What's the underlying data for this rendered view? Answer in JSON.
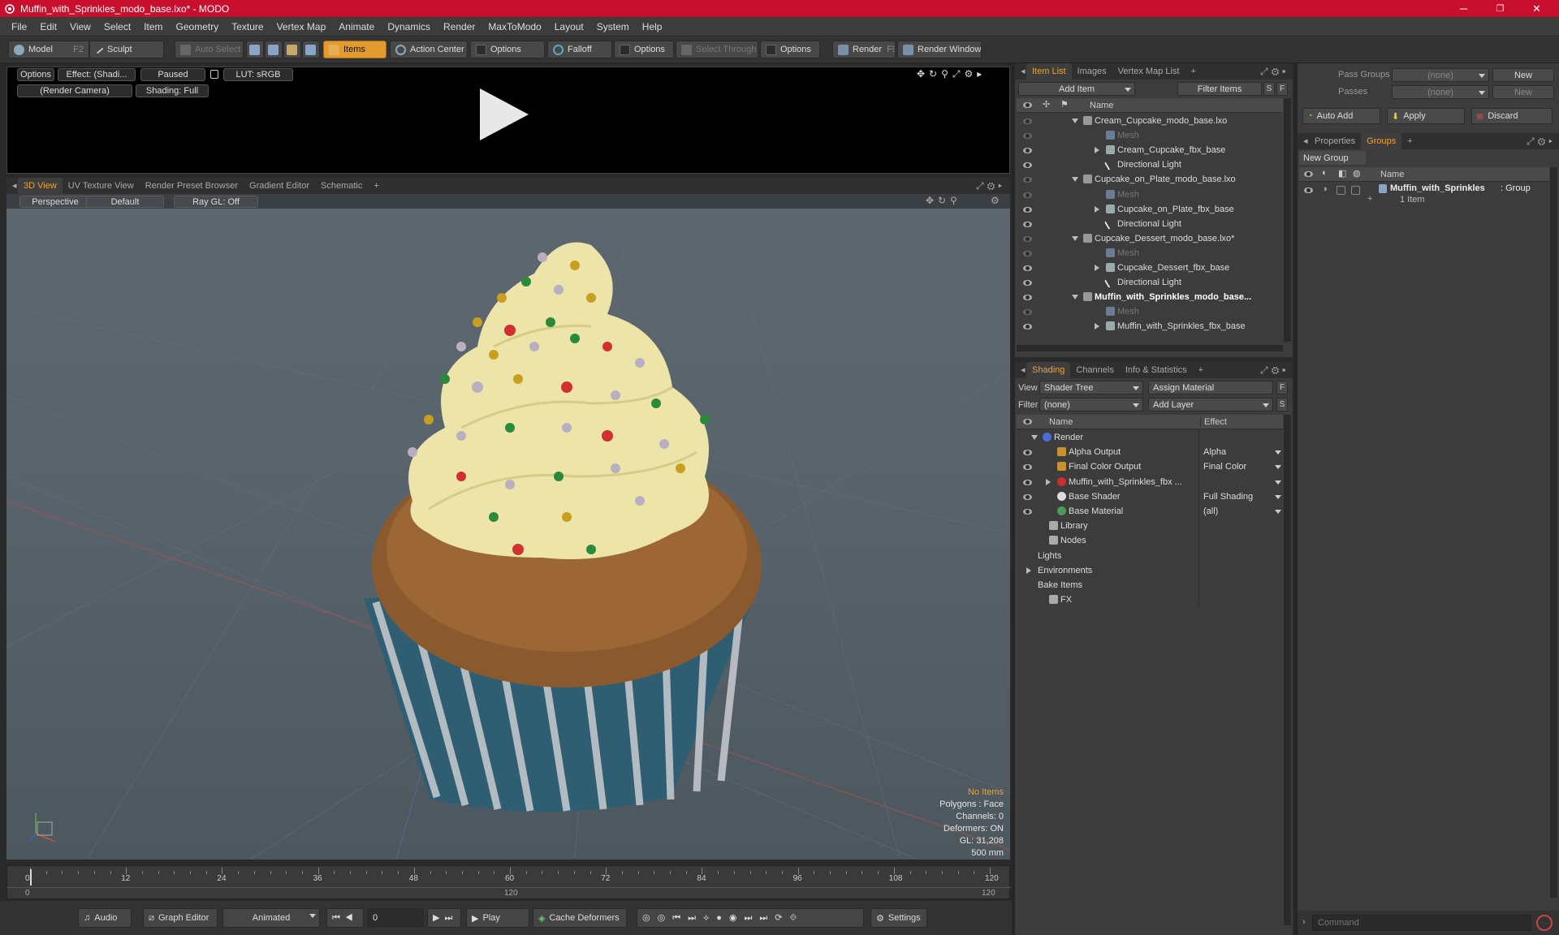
{
  "window": {
    "title": "Muffin_with_Sprinkles_modo_base.lxo* - MODO",
    "min": "─",
    "max": "❐",
    "close": "✕"
  },
  "menu": [
    "File",
    "Edit",
    "View",
    "Select",
    "Item",
    "Geometry",
    "Texture",
    "Vertex Map",
    "Animate",
    "Dynamics",
    "Render",
    "MaxToModo",
    "Layout",
    "System",
    "Help"
  ],
  "toolbar": {
    "model": "Model",
    "model_key": "F2",
    "sculpt": "Sculpt",
    "auto_select": "Auto Select",
    "items": "Items",
    "action_center": "Action Center",
    "options1": "Options",
    "falloff": "Falloff",
    "options2": "Options",
    "select_through": "Select Through",
    "options3": "Options",
    "render": "Render",
    "render_key": "F9",
    "render_window": "Render Window"
  },
  "render_preview": {
    "options": "Options",
    "effect": "Effect: (Shadi...",
    "paused": "Paused",
    "lut": "LUT: sRGB",
    "camera": "(Render Camera)",
    "shading": "Shading: Full"
  },
  "viewport_tabs": [
    "3D View",
    "UV Texture View",
    "Render Preset Browser",
    "Gradient Editor",
    "Schematic",
    "+"
  ],
  "viewport": {
    "perspective": "Perspective",
    "default": "Default",
    "raygl": "Ray GL: Off",
    "info": {
      "no_items": "No Items",
      "polygons": "Polygons : Face",
      "channels": "Channels: 0",
      "deformers": "Deformers: ON",
      "gl": "GL: 31,208",
      "scale": "500 mm"
    }
  },
  "timeline": {
    "ticks": [
      "0",
      "12",
      "24",
      "36",
      "48",
      "60",
      "72",
      "84",
      "96",
      "108",
      "120"
    ],
    "start": "0",
    "mid": "120",
    "end": "120"
  },
  "bottom": {
    "audio": "Audio",
    "graph_editor": "Graph Editor",
    "animated": "Animated",
    "frame": "0",
    "play": "Play",
    "cache": "Cache Deformers",
    "settings": "Settings"
  },
  "item_list": {
    "tabs": [
      "Item List",
      "Images",
      "Vertex Map List",
      "+"
    ],
    "add_item": "Add Item",
    "filter": "Filter Items",
    "s": "S",
    "f": "F",
    "col_name": "Name",
    "rows": [
      {
        "label": "Cream_Cupcake_modo_base.lxo",
        "bold": false
      },
      {
        "label": "Mesh",
        "bold": false
      },
      {
        "label": "Cream_Cupcake_fbx_base",
        "bold": false
      },
      {
        "label": "Directional Light",
        "bold": false
      },
      {
        "label": "Cupcake_on_Plate_modo_base.lxo",
        "bold": false
      },
      {
        "label": "Mesh",
        "bold": false
      },
      {
        "label": "Cupcake_on_Plate_fbx_base",
        "bold": false
      },
      {
        "label": "Directional Light",
        "bold": false
      },
      {
        "label": "Cupcake_Dessert_modo_base.lxo*",
        "bold": false
      },
      {
        "label": "Mesh",
        "bold": false
      },
      {
        "label": "Cupcake_Dessert_fbx_base",
        "bold": false
      },
      {
        "label": "Directional Light",
        "bold": false
      },
      {
        "label": "Muffin_with_Sprinkles_modo_base...",
        "bold": true
      },
      {
        "label": "Mesh",
        "bold": false
      },
      {
        "label": "Muffin_with_Sprinkles_fbx_base",
        "bold": false
      }
    ]
  },
  "shading": {
    "tabs": [
      "Shading",
      "Channels",
      "Info & Statistics",
      "+"
    ],
    "view_label": "View",
    "view_value": "Shader Tree",
    "assign": "Assign Material",
    "filter_label": "Filter",
    "filter_value": "(none)",
    "add_layer": "Add Layer",
    "f": "F",
    "s": "S",
    "col_name": "Name",
    "col_effect": "Effect",
    "rows": [
      {
        "label": "Render",
        "effect": ""
      },
      {
        "label": "Alpha Output",
        "effect": "Alpha"
      },
      {
        "label": "Final Color Output",
        "effect": "Final Color"
      },
      {
        "label": "Muffin_with_Sprinkles_fbx ...",
        "effect": ""
      },
      {
        "label": "Base Shader",
        "effect": "Full Shading"
      },
      {
        "label": "Base Material",
        "effect": "(all)"
      },
      {
        "label": "Library",
        "effect": ""
      },
      {
        "label": "Nodes",
        "effect": ""
      },
      {
        "label": "Lights",
        "effect": ""
      },
      {
        "label": "Environments",
        "effect": ""
      },
      {
        "label": "Bake Items",
        "effect": ""
      },
      {
        "label": "FX",
        "effect": ""
      }
    ]
  },
  "groups": {
    "pass_groups": "Pass Groups",
    "pass_groups_val": "(none)",
    "passes": "Passes",
    "passes_val": "(none)",
    "new1": "New",
    "new2": "New",
    "auto_add": "Auto Add",
    "apply": "Apply",
    "discard": "Discard",
    "tabs": [
      "Properties",
      "Groups",
      "+"
    ],
    "new_group": "New Group",
    "col_name": "Name",
    "group_name": "Muffin_with_Sprinkles",
    "group_suffix": ": Group",
    "group_count": "1 Item"
  },
  "command": {
    "placeholder": "Command"
  },
  "colors": {
    "accent": "#f0a030",
    "titlebar": "#c8102e"
  }
}
